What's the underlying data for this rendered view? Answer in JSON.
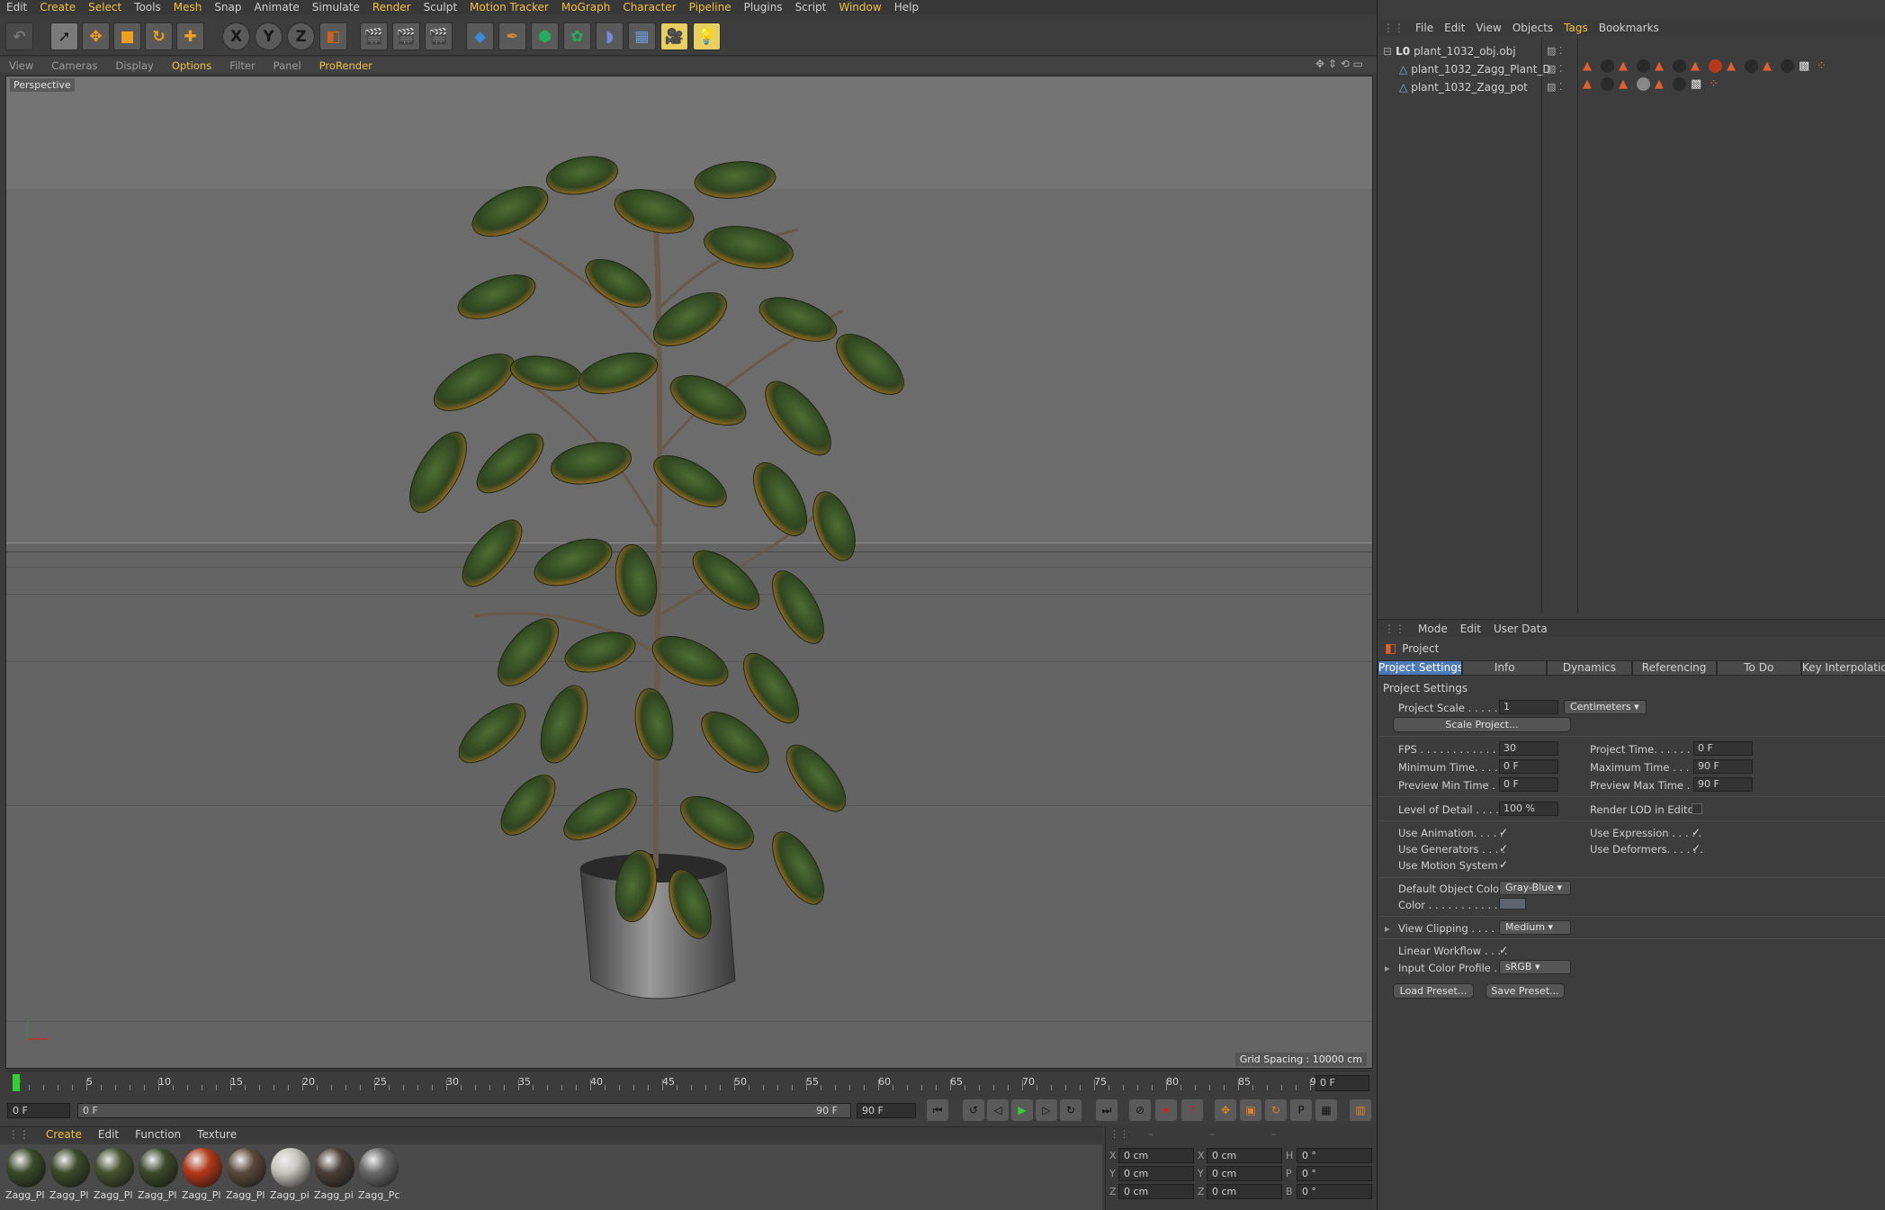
{
  "menubar": {
    "items": [
      "Edit",
      "Create",
      "Select",
      "Tools",
      "Mesh",
      "Snap",
      "Animate",
      "Simulate",
      "Render",
      "Sculpt",
      "Motion Tracker",
      "MoGraph",
      "Character",
      "Pipeline",
      "Plugins",
      "Script",
      "Window",
      "Help"
    ]
  },
  "viewport": {
    "menu": [
      "View",
      "Cameras",
      "Display",
      "Options",
      "Filter",
      "Panel",
      "ProRender"
    ],
    "camera_label": "Perspective",
    "grid_spacing": "Grid Spacing : 10000 cm"
  },
  "timeline": {
    "ticks": [
      "0",
      "5",
      "10",
      "15",
      "20",
      "25",
      "30",
      "35",
      "40",
      "45",
      "50",
      "55",
      "60",
      "65",
      "70",
      "75",
      "80",
      "85",
      "90"
    ],
    "current_frame": "0 F"
  },
  "transport": {
    "start_field": "0 F",
    "range_start": "0 F",
    "range_end": "90 F",
    "end_field": "90 F"
  },
  "material_menu": {
    "items": [
      "Create",
      "Edit",
      "Function",
      "Texture"
    ]
  },
  "materials": [
    {
      "name": "Zagg_Pl",
      "color": "#3a4a2a"
    },
    {
      "name": "Zagg_Pl",
      "color": "#3d4b2c"
    },
    {
      "name": "Zagg_Pl",
      "color": "#46522f"
    },
    {
      "name": "Zagg_Pl",
      "color": "#3c4a2b"
    },
    {
      "name": "Zagg_Pl",
      "color": "#b5391a"
    },
    {
      "name": "Zagg_Pl",
      "color": "#5a4a3c"
    },
    {
      "name": "Zagg_pi",
      "color": "#c8c6c0"
    },
    {
      "name": "Zagg_pi",
      "color": "#4b3f38"
    },
    {
      "name": "Zagg_Pc",
      "color": "#6a6a6a"
    }
  ],
  "coordinates": {
    "x_pos": "0 cm",
    "y_pos": "0 cm",
    "z_pos": "0 cm",
    "x_size": "0 cm",
    "y_size": "0 cm",
    "z_size": "0 cm",
    "h_rot": "0 °",
    "p_rot": "0 °",
    "b_rot": "0 °",
    "axis_x": "X",
    "axis_y": "Y",
    "axis_z": "Z",
    "rot_h": "H",
    "rot_p": "P",
    "rot_b": "B"
  },
  "object_manager": {
    "menu": [
      "File",
      "Edit",
      "View",
      "Objects",
      "Tags",
      "Bookmarks"
    ],
    "objects": [
      {
        "name": "plant_1032_obj.obj"
      },
      {
        "name": "plant_1032_Zagg_Plant_D"
      },
      {
        "name": "plant_1032_Zagg_pot"
      }
    ]
  },
  "attributes": {
    "menu": [
      "Mode",
      "Edit",
      "User Data"
    ],
    "title": "Project",
    "tabs": [
      "Project Settings",
      "Info",
      "Dynamics",
      "Referencing",
      "To Do",
      "Key Interpolation"
    ],
    "section": "Project Settings",
    "project_scale_label": "Project Scale . . . . . .",
    "project_scale_value": "1",
    "project_scale_unit": "Centimeters",
    "scale_project_button": "Scale Project...",
    "fps_label": "FPS . . . . . . . . . . . . . .",
    "fps_value": "30",
    "project_time_label": "Project Time. . . . . . . .",
    "project_time_value": "0 F",
    "min_time_label": "Minimum Time. . . . . .",
    "min_time_value": "0 F",
    "max_time_label": "Maximum Time . . . . .",
    "max_time_value": "90 F",
    "prev_min_label": "Preview Min Time . . .",
    "prev_min_value": "0 F",
    "prev_max_label": "Preview Max Time . . .",
    "prev_max_value": "90 F",
    "lod_label": "Level of Detail . . . . .",
    "lod_value": "100 %",
    "render_lod_label": "Render LOD in Editor",
    "use_anim_label": "Use Animation. . . . .",
    "use_expr_label": "Use Expression . . . . .",
    "use_gen_label": "Use Generators . . . .",
    "use_def_label": "Use Deformers. . . . . .",
    "use_motion_label": "Use Motion System",
    "def_color_label": "Default Object Color",
    "def_color_value": "Gray-Blue",
    "color_label": "Color . . . . . . . . . . .",
    "view_clip_label": "View Clipping . . . . . .",
    "view_clip_value": "Medium",
    "linear_label": "Linear Workflow . . . .",
    "input_profile_label": "Input Color Profile . .",
    "input_profile_value": "sRGB",
    "load_preset": "Load Preset...",
    "save_preset": "Save Preset...",
    "check": "✓"
  }
}
